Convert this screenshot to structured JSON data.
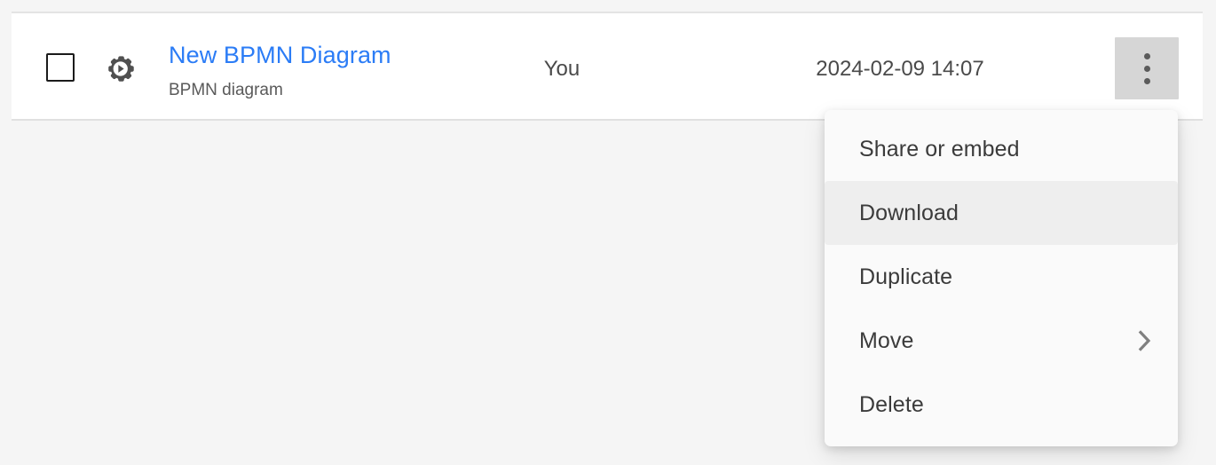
{
  "row": {
    "checkbox_checked": false,
    "type_icon": "gear-play-icon",
    "name": "New BPMN Diagram",
    "subtitle": "BPMN diagram",
    "creator": "You",
    "modified": "2024-02-09 14:07",
    "menu_button_icon": "kebab-menu-icon",
    "accent_color": "#2b7cf6",
    "menu_button_active_color": "#d6d6d6"
  },
  "context_menu": {
    "highlighted_index": 1,
    "background_color": "#fafafa",
    "highlight_color": "#eeeeee",
    "items": [
      {
        "label": "Share or embed",
        "has_submenu": false
      },
      {
        "label": "Download",
        "has_submenu": false
      },
      {
        "label": "Duplicate",
        "has_submenu": false
      },
      {
        "label": "Move",
        "has_submenu": true,
        "submenu_icon": "chevron-right-icon"
      },
      {
        "label": "Delete",
        "has_submenu": false
      }
    ]
  }
}
